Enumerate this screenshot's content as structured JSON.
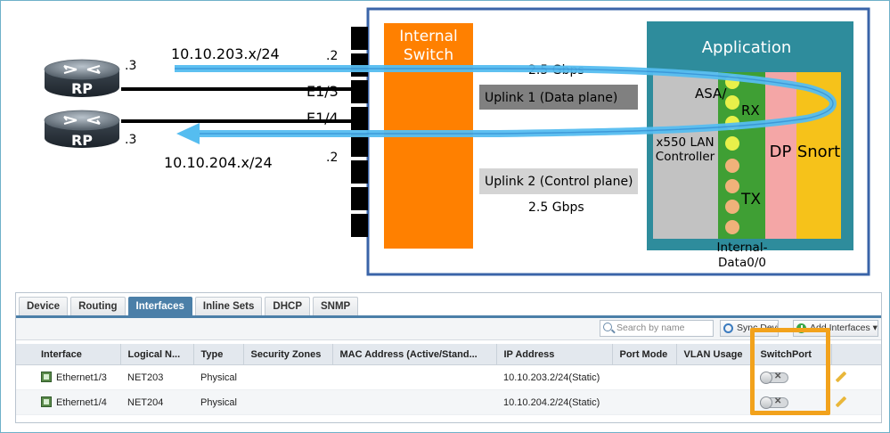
{
  "diagram": {
    "left_router": {
      "label": "RP"
    },
    "right_router": {
      "label": "RP"
    },
    "top_router_octet": ".3",
    "bottom_router_octet": ".3",
    "top_subnet": "10.10.203.x/24",
    "bottom_subnet": "10.10.204.x/24",
    "top_gw_octet": ".2",
    "bottom_gw_octet": ".2",
    "port_e13": "E1/3",
    "port_e14": "E1/4",
    "internal_switch": {
      "line1": "Internal",
      "line2": "Switch"
    },
    "uplink1_speed": "2.5 Gbps",
    "uplink1_label": "Uplink 1 (Data plane)",
    "uplink2_label": "Uplink 2 (Control plane)",
    "uplink2_speed": "2.5 Gbps",
    "application_title": "Application",
    "lan_controller": {
      "line1": "x550 LAN",
      "line2": "Controller"
    },
    "asa_label": "ASA/",
    "rx_label": "RX",
    "tx_label": "TX",
    "dp_label": "DP",
    "snort_label": "Snort",
    "internal_data": {
      "line1": "Internal-",
      "line2": "Data0/0"
    },
    "colors": {
      "blade_border": "#3a64a8",
      "internal_switch": "#ff8000",
      "application": "#2e8c9c",
      "green_bar": "#3f9f34",
      "dp": "#f4a6a6",
      "snort": "#f6c21a",
      "flow_arrow": "#55bdf0"
    }
  },
  "tabs": [
    {
      "label": "Device",
      "active": false
    },
    {
      "label": "Routing",
      "active": false
    },
    {
      "label": "Interfaces",
      "active": true
    },
    {
      "label": "Inline Sets",
      "active": false
    },
    {
      "label": "DHCP",
      "active": false
    },
    {
      "label": "SNMP",
      "active": false
    }
  ],
  "toolbar": {
    "search_placeholder": "Search by name",
    "sync_label": "Sync Device",
    "add_label": "Add Interfaces"
  },
  "table": {
    "columns": [
      "Interface",
      "Logical N...",
      "Type",
      "Security Zones",
      "MAC Address (Active/Stand...",
      "IP Address",
      "Port Mode",
      "VLAN Usage",
      "SwitchPort"
    ],
    "rows": [
      {
        "interface": "Ethernet1/3",
        "logical_name": "NET203",
        "type": "Physical",
        "security_zones": "",
        "mac": "",
        "ip": "10.10.203.2/24(Static)",
        "port_mode": "",
        "vlan_usage": "",
        "switchport": "off"
      },
      {
        "interface": "Ethernet1/4",
        "logical_name": "NET204",
        "type": "Physical",
        "security_zones": "",
        "mac": "",
        "ip": "10.10.204.2/24(Static)",
        "port_mode": "",
        "vlan_usage": "",
        "switchport": "off"
      }
    ]
  }
}
